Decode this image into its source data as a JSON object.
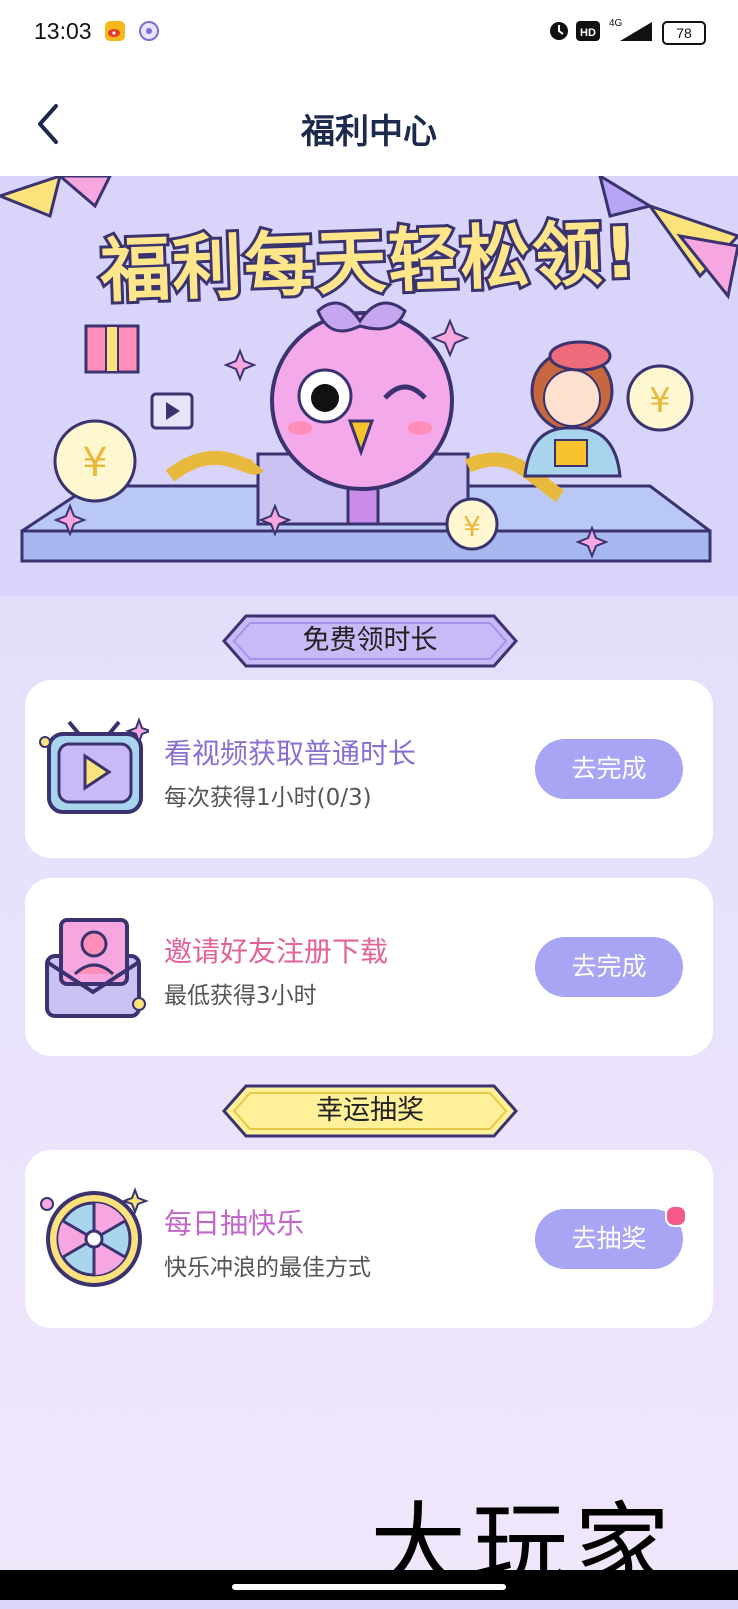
{
  "status_bar": {
    "time": "13:03",
    "network": "4G",
    "battery": "78",
    "icons": [
      "weibo-icon",
      "app-icon",
      "alarm-icon",
      "hd-icon",
      "signal-icon",
      "battery-icon"
    ]
  },
  "header": {
    "title": "福利中心",
    "back_icon": "chevron-left-icon"
  },
  "banner": {
    "title": "福利每天轻松领!"
  },
  "sections": {
    "free_time": "免费领时长",
    "lottery": "幸运抽奖"
  },
  "tasks": [
    {
      "icon": "tv-play-icon",
      "title": "看视频获取普通时长",
      "subtitle": "每次获得1小时(0/3)",
      "button": "去完成",
      "title_color": "#8a6fd0"
    },
    {
      "icon": "invite-envelope-icon",
      "title": "邀请好友注册下载",
      "subtitle": "最低获得3小时",
      "button": "去完成",
      "title_color": "#e2629a"
    }
  ],
  "lottery_task": {
    "icon": "prize-wheel-icon",
    "title": "每日抽快乐",
    "subtitle": "快乐冲浪的最佳方式",
    "button": "去抽奖",
    "title_color": "#c267c7"
  },
  "watermark": "大玩家",
  "colors": {
    "accent_button": "#a7a5f4",
    "ribbon_purple": "#c9b9f7",
    "ribbon_yellow": "#fff09a",
    "badge_dot": "#f35a8a"
  }
}
